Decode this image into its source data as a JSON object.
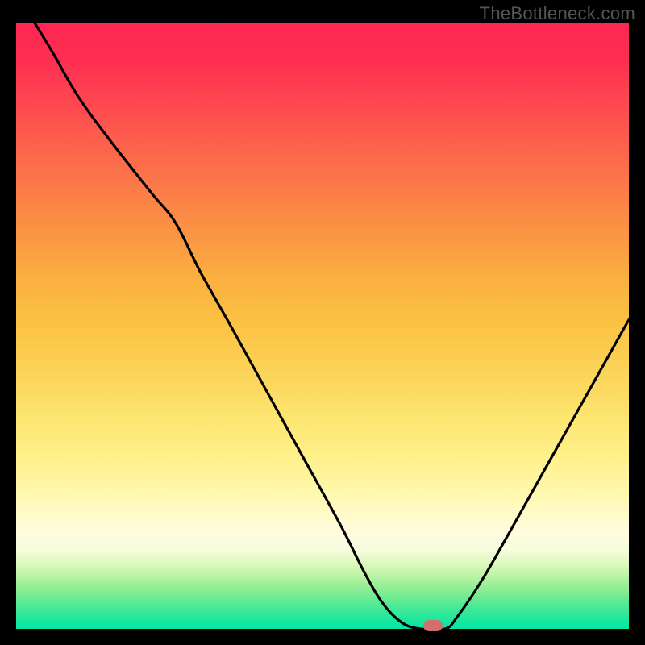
{
  "watermark": "TheBottleneck.com",
  "colors": {
    "gradient_top": "#fd2752",
    "gradient_mid": "#fbd45a",
    "gradient_bottom": "#04e7a5",
    "curve": "#000000",
    "marker": "#d26f6d",
    "background": "#000000"
  },
  "chart_data": {
    "type": "line",
    "title": "",
    "xlabel": "",
    "ylabel": "",
    "xlim": [
      0,
      100
    ],
    "ylim": [
      0,
      100
    ],
    "x": [
      3,
      6,
      10,
      15,
      22,
      26,
      30,
      35,
      41,
      47,
      53,
      57,
      60,
      63,
      66,
      70,
      72,
      76,
      80,
      85,
      90,
      95,
      100
    ],
    "values": [
      100,
      95,
      88,
      81,
      72,
      67,
      59,
      50,
      39,
      28,
      17,
      9,
      4,
      1,
      0,
      0,
      2,
      8,
      15,
      24,
      33,
      42,
      51
    ],
    "marker_point": {
      "x": 68,
      "y": 0.5
    },
    "description": "V-shaped curve on vertical rainbow heat gradient"
  }
}
